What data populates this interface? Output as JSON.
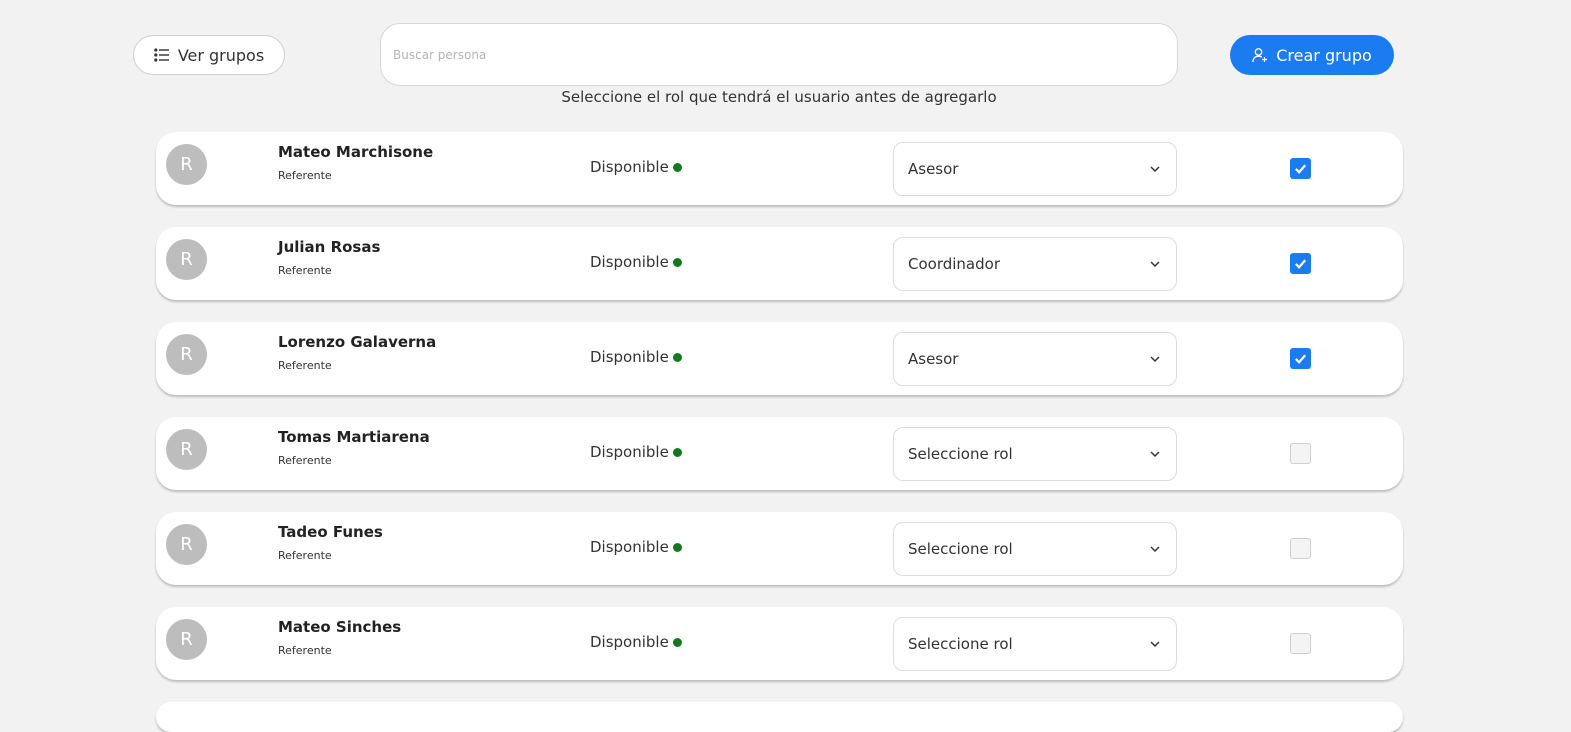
{
  "toolbar": {
    "view_groups_label": "Ver grupos",
    "view_groups_icon": "list-icon",
    "search_placeholder": "Buscar persona",
    "search_value": "",
    "create_group_label": "Crear grupo",
    "create_group_icon": "add-user-icon"
  },
  "hint": "Seleccione el rol que tendrá el usuario antes de agregarlo",
  "colors": {
    "accent": "#1a7cf0",
    "status_ok": "#127a1c",
    "avatar": "#bdbdbd"
  },
  "users": [
    {
      "initial": "R",
      "name": "Mateo Marchisone",
      "subtitle": "Referente",
      "status": "Disponible",
      "role": "Asesor",
      "selected": true
    },
    {
      "initial": "R",
      "name": "Julian Rosas",
      "subtitle": "Referente",
      "status": "Disponible",
      "role": "Coordinador",
      "selected": true
    },
    {
      "initial": "R",
      "name": "Lorenzo Galaverna",
      "subtitle": "Referente",
      "status": "Disponible",
      "role": "Asesor",
      "selected": true
    },
    {
      "initial": "R",
      "name": "Tomas Martiarena",
      "subtitle": "Referente",
      "status": "Disponible",
      "role": "Seleccione rol",
      "selected": false
    },
    {
      "initial": "R",
      "name": "Tadeo Funes",
      "subtitle": "Referente",
      "status": "Disponible",
      "role": "Seleccione rol",
      "selected": false
    },
    {
      "initial": "R",
      "name": "Mateo Sinches",
      "subtitle": "Referente",
      "status": "Disponible",
      "role": "Seleccione rol",
      "selected": false
    }
  ]
}
